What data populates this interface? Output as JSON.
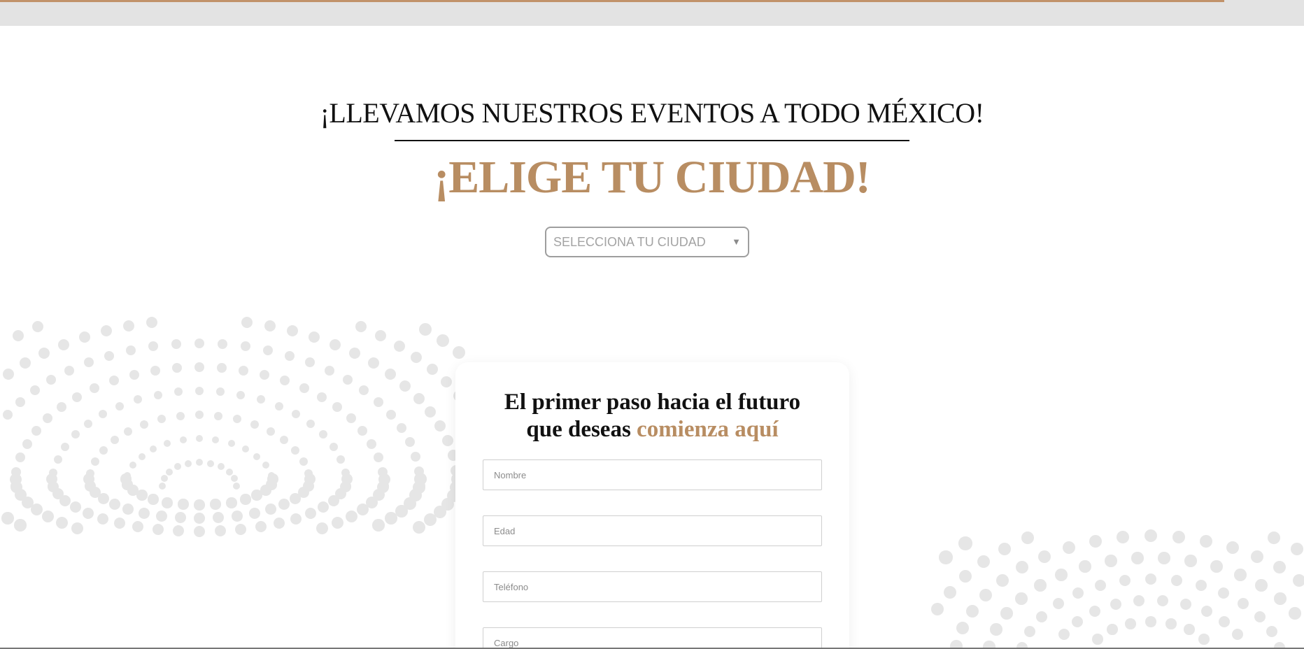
{
  "header": {
    "headline": "¡LLEVAMOS NUESTROS EVENTOS A TODO MÉXICO!",
    "city_title": "¡ELIGE TU CIUDAD!"
  },
  "city_select": {
    "selected": "SELECCIONA TU CIUDAD",
    "arrow": "▼"
  },
  "form": {
    "title_line1": "El primer paso hacia el futuro",
    "title_line2_prefix": "que deseas ",
    "title_line2_accent": "comienza aquí",
    "fields": [
      {
        "placeholder": "Nombre"
      },
      {
        "placeholder": "Edad"
      },
      {
        "placeholder": "Teléfono"
      },
      {
        "placeholder": "Cargo"
      }
    ]
  },
  "colors": {
    "accent": "#b88d62",
    "text": "#111111",
    "dots": "#e6e6e6",
    "top_bar": "#e3e3e3"
  }
}
